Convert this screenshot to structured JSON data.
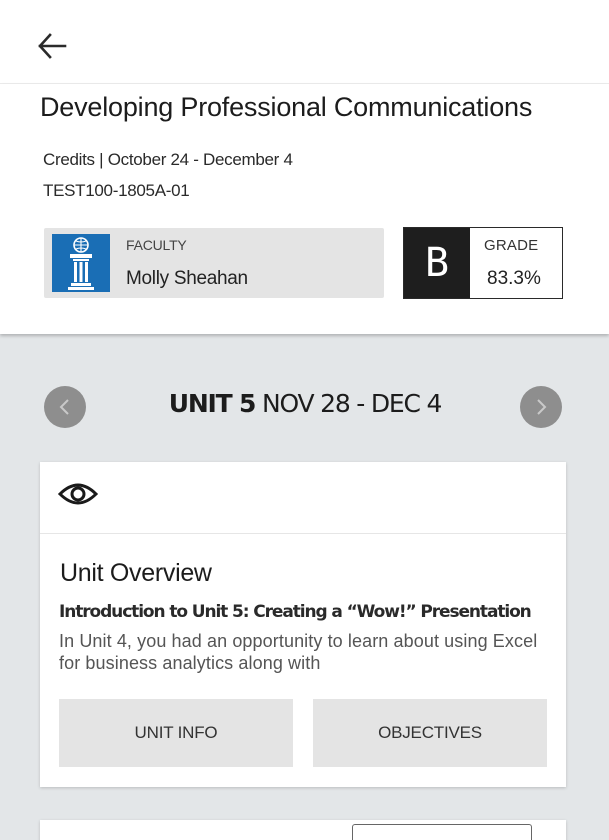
{
  "header": {
    "back_icon": "arrow-left-icon"
  },
  "course": {
    "title": "Developing Professional Communications",
    "meta": "Credits | October 24 - December 4",
    "code": "TEST100-1805A-01"
  },
  "faculty": {
    "label": "FACULTY",
    "name": "Molly Sheahan",
    "logo_icon": "university-pillar-logo",
    "logo_color": "#1a6eb5"
  },
  "grade": {
    "label": "GRADE",
    "letter": "B",
    "percent": "83.3%",
    "letter_bg": "#1e1e1e"
  },
  "unit_nav": {
    "unit_name": "UNIT 5",
    "dates": " NOV 28 - DEC 4",
    "prev_icon": "chevron-left-icon",
    "next_icon": "chevron-right-icon"
  },
  "overview_card": {
    "icon": "eye-icon",
    "title": "Unit Overview",
    "subtitle": "Introduction to Unit 5:  Creating a “Wow!” Presentation",
    "description": "In Unit 4, you had an opportunity to learn about using Excel for business analytics along with",
    "buttons": {
      "unit_info": "UNIT INFO",
      "objectives": "OBJECTIVES"
    }
  },
  "colors": {
    "content_bg": "#e3e6e8",
    "button_bg": "#e4e4e4",
    "nav_arrow_bg": "#8e8e8e"
  }
}
